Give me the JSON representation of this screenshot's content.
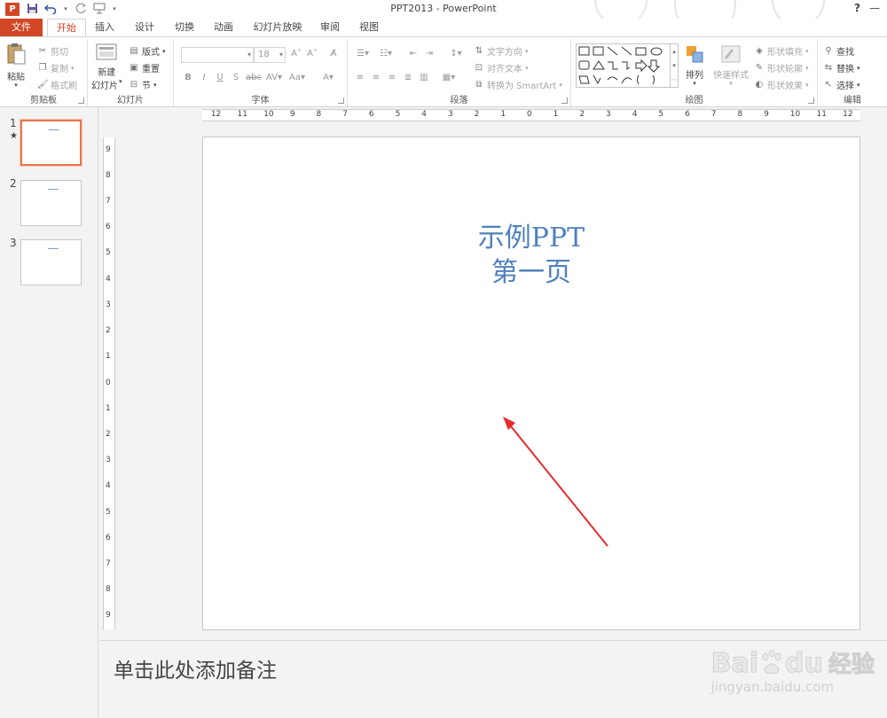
{
  "titlebar": {
    "app_logo": "P",
    "title": "PPT2013 - PowerPoint",
    "help": "?",
    "minimize": "—"
  },
  "tabs": [
    {
      "label": "文件",
      "state": "file"
    },
    {
      "label": "开始",
      "state": "active"
    },
    {
      "label": "插入"
    },
    {
      "label": "设计"
    },
    {
      "label": "切换"
    },
    {
      "label": "动画"
    },
    {
      "label": "幻灯片放映"
    },
    {
      "label": "审阅"
    },
    {
      "label": "视图"
    }
  ],
  "ribbon": {
    "clipboard": {
      "paste": "粘贴",
      "cut": "剪切",
      "copy": "复制",
      "format_painter": "格式刷",
      "label": "剪贴板"
    },
    "slides": {
      "new_slide": "新建",
      "new_slide2": "幻灯片",
      "layout": "版式",
      "reset": "重置",
      "section": "节",
      "label": "幻灯片"
    },
    "font": {
      "size": "18",
      "label": "字体"
    },
    "paragraph": {
      "text_direction": "文字方向",
      "align_text": "对齐文本",
      "smartart": "转换为 SmartArt",
      "label": "段落"
    },
    "drawing": {
      "arrange": "排列",
      "quick_styles": "快速样式",
      "shape_fill": "形状填充",
      "shape_outline": "形状轮廓",
      "shape_effects": "形状效果",
      "label": "绘图"
    },
    "editing": {
      "find": "查找",
      "replace": "替换",
      "select": "选择",
      "label": "编辑"
    }
  },
  "ruler": {
    "h": [
      "12",
      "11",
      "10",
      "9",
      "8",
      "7",
      "6",
      "5",
      "4",
      "3",
      "2",
      "1",
      "0",
      "1",
      "2",
      "3",
      "4",
      "5",
      "6",
      "7",
      "8",
      "9",
      "10",
      "11",
      "12"
    ],
    "v": [
      "9",
      "8",
      "7",
      "6",
      "5",
      "4",
      "3",
      "2",
      "1",
      "0",
      "1",
      "2",
      "3",
      "4",
      "5",
      "6",
      "7",
      "8",
      "9"
    ]
  },
  "thumbnails": [
    {
      "num": "1",
      "star": "★"
    },
    {
      "num": "2"
    },
    {
      "num": "3"
    }
  ],
  "slide": {
    "line1": "示例PPT",
    "line2": "第一页"
  },
  "notes": {
    "placeholder": "单击此处添加备注"
  },
  "watermark": {
    "brand": "Bai",
    "brand2": "du",
    "site": "经验",
    "url": "jingyan.baidu.com"
  },
  "colors": {
    "accent": "#d24726",
    "title_text": "#4f81bd",
    "annotation_arrow": "#e52b2b"
  }
}
